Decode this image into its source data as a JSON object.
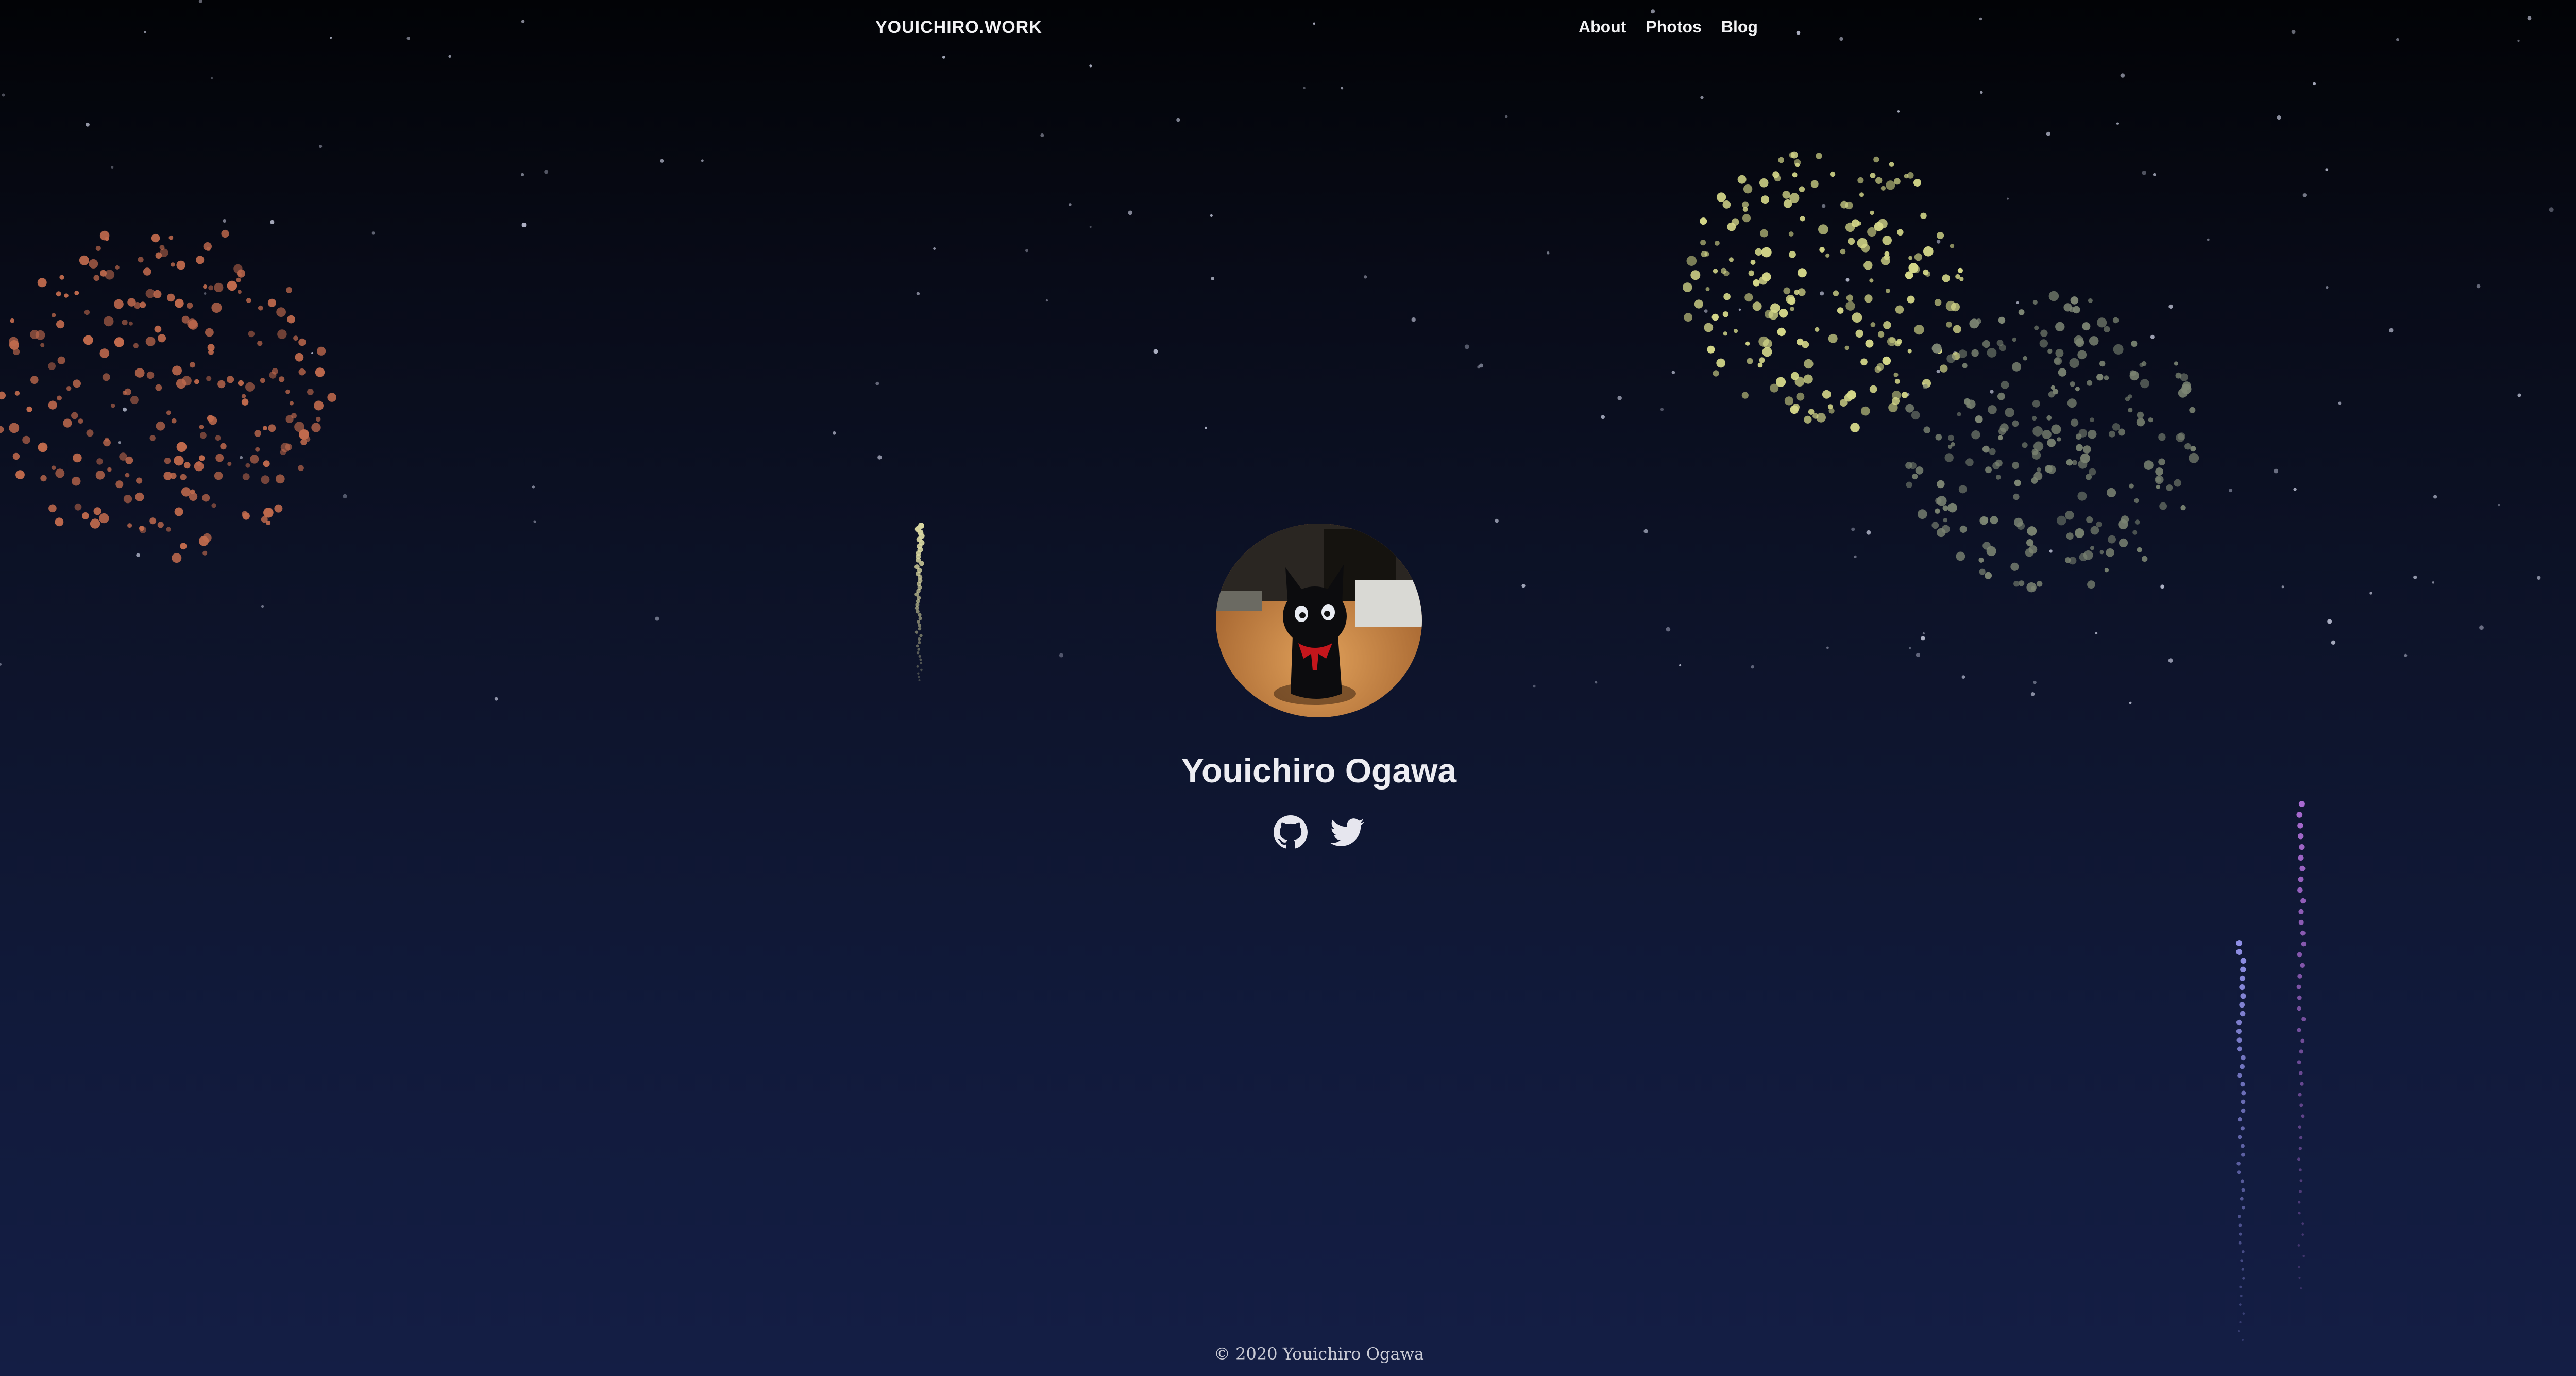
{
  "nav": {
    "brand": "YOUICHIRO.WORK",
    "links": [
      "About",
      "Photos",
      "Blog"
    ]
  },
  "profile": {
    "name": "Youichiro Ogawa",
    "avatar_alt": "black cat figurine photo",
    "social": [
      {
        "icon": "github-icon"
      },
      {
        "icon": "twitter-icon"
      }
    ]
  },
  "footer": {
    "copyright": "© 2020 Youichiro Ogawa"
  },
  "colors": {
    "sky_top": "#020306",
    "sky_bottom": "#141e45",
    "firework_orange": "#c06a4d",
    "firework_yellow": "#d6d98a",
    "firework_gray": "#7c8573",
    "rocket_violet": "#a86ad0",
    "rocket_blue": "#8f8fe6",
    "rocket_cream": "#d8d6a0"
  }
}
